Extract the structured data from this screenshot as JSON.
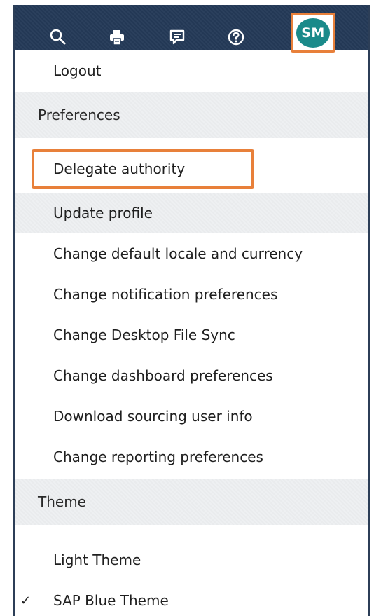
{
  "toolbar": {
    "icons": [
      "search-icon",
      "print-icon",
      "feedback-icon",
      "help-icon"
    ],
    "avatar_initials": "SM"
  },
  "menu": {
    "logout": "Logout",
    "preferences_header": "Preferences",
    "preferences_items": [
      "Delegate authority",
      "Update profile",
      "Change default locale and currency",
      "Change notification preferences",
      "Change Desktop File Sync",
      "Change dashboard preferences",
      "Download sourcing user info",
      "Change reporting preferences"
    ],
    "theme_header": "Theme",
    "theme_items": [
      "Light Theme",
      "SAP Blue Theme"
    ],
    "selected_theme_check": "✓"
  },
  "colors": {
    "topbar": "#243a58",
    "highlight": "#e8803a",
    "avatar": "#1a8a8a"
  }
}
